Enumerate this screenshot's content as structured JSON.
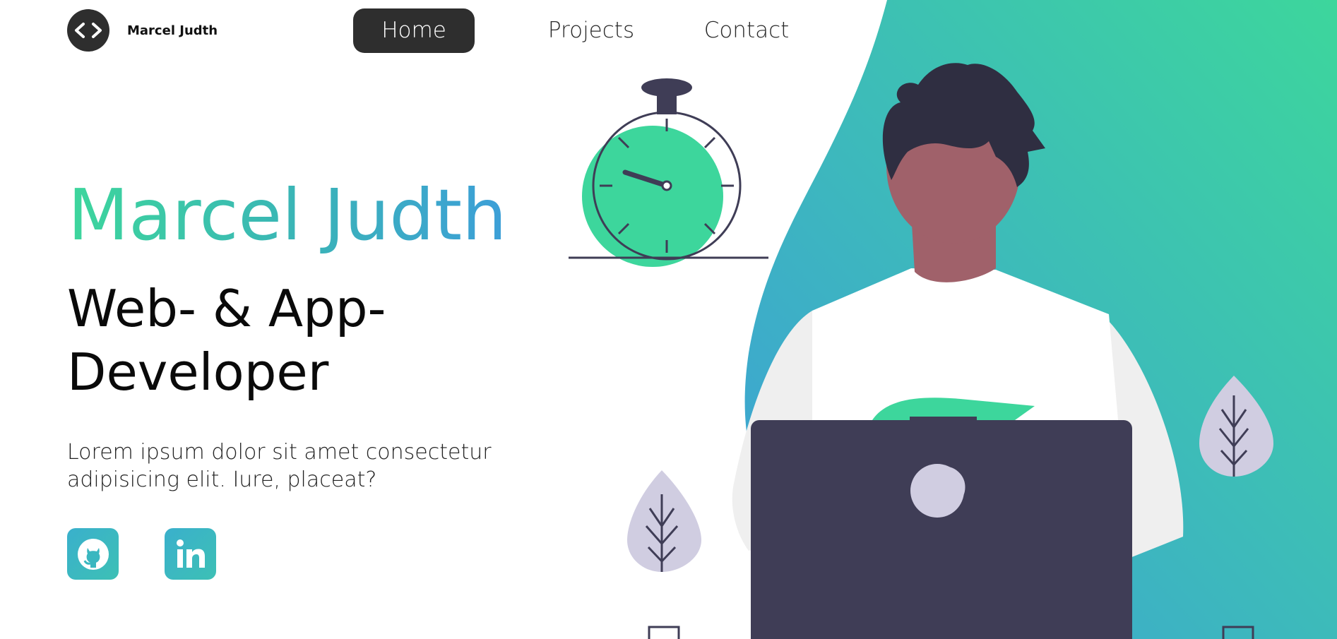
{
  "logo": {
    "glyph": "<>",
    "name": "Marcel Judth"
  },
  "nav": {
    "items": [
      {
        "label": "Home",
        "active": true
      },
      {
        "label": "Projects",
        "active": false
      },
      {
        "label": "Contact",
        "active": false
      }
    ]
  },
  "hero": {
    "name": "Marcel Judth",
    "role_line1": "Web- & App-",
    "role_line2": "Developer",
    "description": "Lorem ipsum dolor sit amet consectetur adipisicing elit. Iure, placeat?"
  },
  "social": [
    {
      "icon": "github-icon"
    },
    {
      "icon": "linkedin-icon"
    }
  ],
  "colors": {
    "gradient_start": "#3dd69c",
    "gradient_end": "#3d9fd8",
    "dark": "#2e2e2e",
    "laptop": "#3f3d56",
    "skin": "#a0616a",
    "hair": "#2f2e41",
    "leaf": "#d0cde1"
  }
}
